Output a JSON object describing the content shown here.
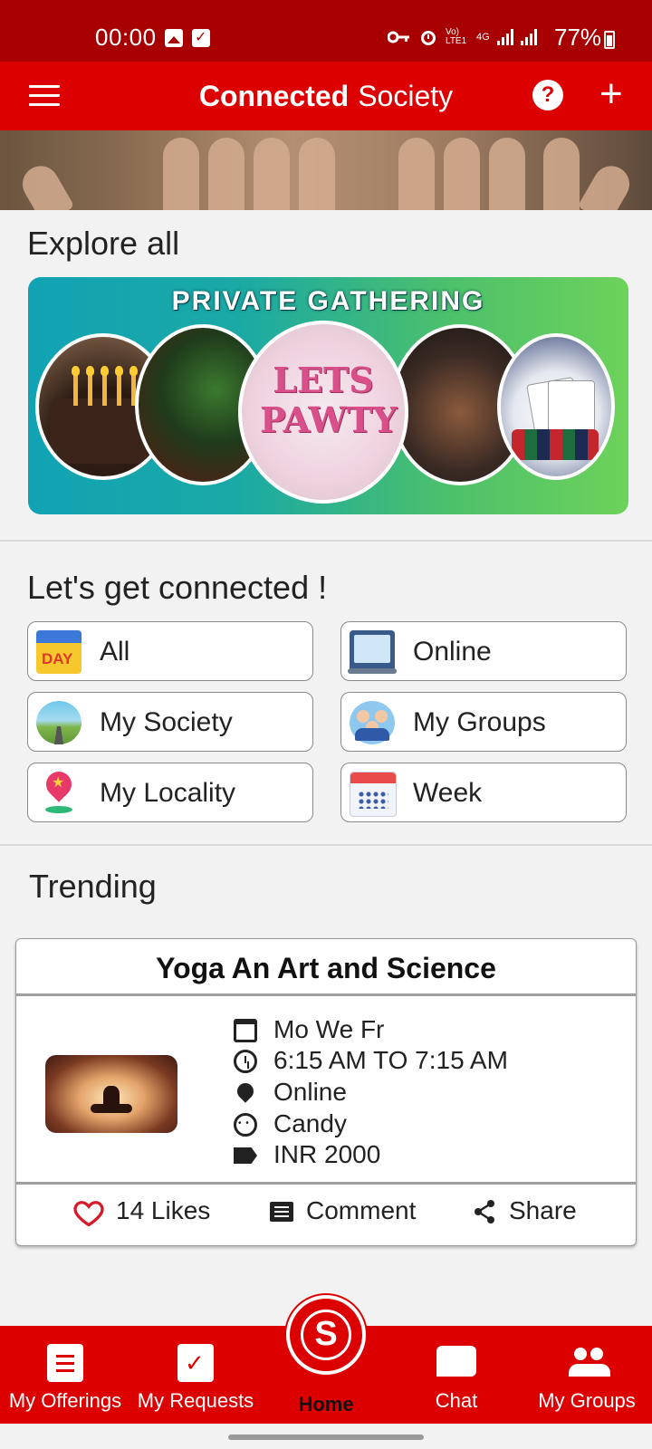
{
  "status_bar": {
    "time": "00:00",
    "network_label": "Vo) LTE1",
    "network_type": "4G",
    "battery": "77%"
  },
  "app_bar": {
    "title_bold": "Connected",
    "title_regular": "Society",
    "help_label": "?",
    "add_label": "+"
  },
  "explore": {
    "title": "Explore all",
    "banner_title": "PRIVATE GATHERING",
    "banner_text": "LETS PAWTY"
  },
  "connect": {
    "title": "Let's get connected !",
    "filters": [
      {
        "label": "All",
        "icon": "day-calendar-icon"
      },
      {
        "label": "Online",
        "icon": "laptop-icon"
      },
      {
        "label": "My Society",
        "icon": "city-icon"
      },
      {
        "label": "My Groups",
        "icon": "people-icon"
      },
      {
        "label": "My Locality",
        "icon": "location-pin-icon"
      },
      {
        "label": "Week",
        "icon": "week-calendar-icon"
      }
    ],
    "day_icon_text": "DAY"
  },
  "trending": {
    "title": "Trending",
    "card": {
      "title": "Yoga An Art and Science",
      "days": "Mo We Fr",
      "time": "6:15 AM TO 7:15 AM",
      "location": "Online",
      "host": "Candy",
      "price": "INR 2000",
      "likes": "14 Likes",
      "comment": "Comment",
      "share": "Share"
    }
  },
  "bottom_nav": {
    "items": [
      {
        "label": "My Offerings"
      },
      {
        "label": "My Requests"
      },
      {
        "label": "Home"
      },
      {
        "label": "Chat"
      },
      {
        "label": "My Groups"
      }
    ],
    "home_glyph": "S"
  },
  "colors": {
    "primary": "#dc0000",
    "status_bar": "#a80000",
    "background": "#f2f2f2"
  }
}
